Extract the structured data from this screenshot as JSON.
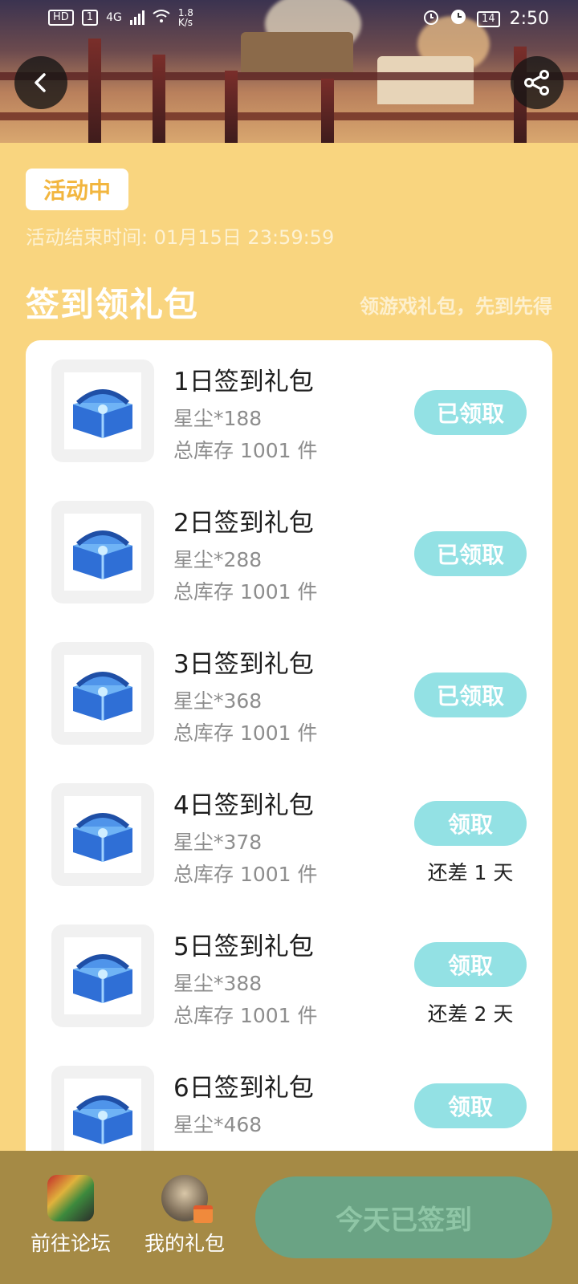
{
  "status_bar": {
    "left_badges": [
      "HD",
      "1",
      "4G"
    ],
    "speed": "1.8",
    "speed_unit": "K/s",
    "battery": "14",
    "time": "2:50"
  },
  "header": {
    "back_icon": "chevron-left-icon",
    "share_icon": "share-icon"
  },
  "activity": {
    "status_badge": "活动中",
    "end_time": "活动结束时间: 01月15日 23:59:59"
  },
  "section": {
    "title": "签到领礼包",
    "subtitle": "领游戏礼包，先到先得"
  },
  "gifts": [
    {
      "title": "1日签到礼包",
      "reward": "星尘*188",
      "stock": "总库存 1001 件",
      "button": "已领取",
      "remain": ""
    },
    {
      "title": "2日签到礼包",
      "reward": "星尘*288",
      "stock": "总库存 1001 件",
      "button": "已领取",
      "remain": ""
    },
    {
      "title": "3日签到礼包",
      "reward": "星尘*368",
      "stock": "总库存 1001 件",
      "button": "已领取",
      "remain": ""
    },
    {
      "title": "4日签到礼包",
      "reward": "星尘*378",
      "stock": "总库存 1001 件",
      "button": "领取",
      "remain": "还差 1 天"
    },
    {
      "title": "5日签到礼包",
      "reward": "星尘*388",
      "stock": "总库存 1001 件",
      "button": "领取",
      "remain": "还差 2 天"
    },
    {
      "title": "6日签到礼包",
      "reward": "星尘*468",
      "stock": "",
      "button": "领取",
      "remain": ""
    }
  ],
  "bottom_bar": {
    "forum_label": "前往论坛",
    "my_gifts_label": "我的礼包",
    "signed_button": "今天已签到"
  },
  "colors": {
    "page_bg": "#f9d57f",
    "claim_button": "#93e1e4",
    "bottom_bar": "#a58a45",
    "signed_button": "#6aa384",
    "badge_text": "#f2b63f"
  }
}
